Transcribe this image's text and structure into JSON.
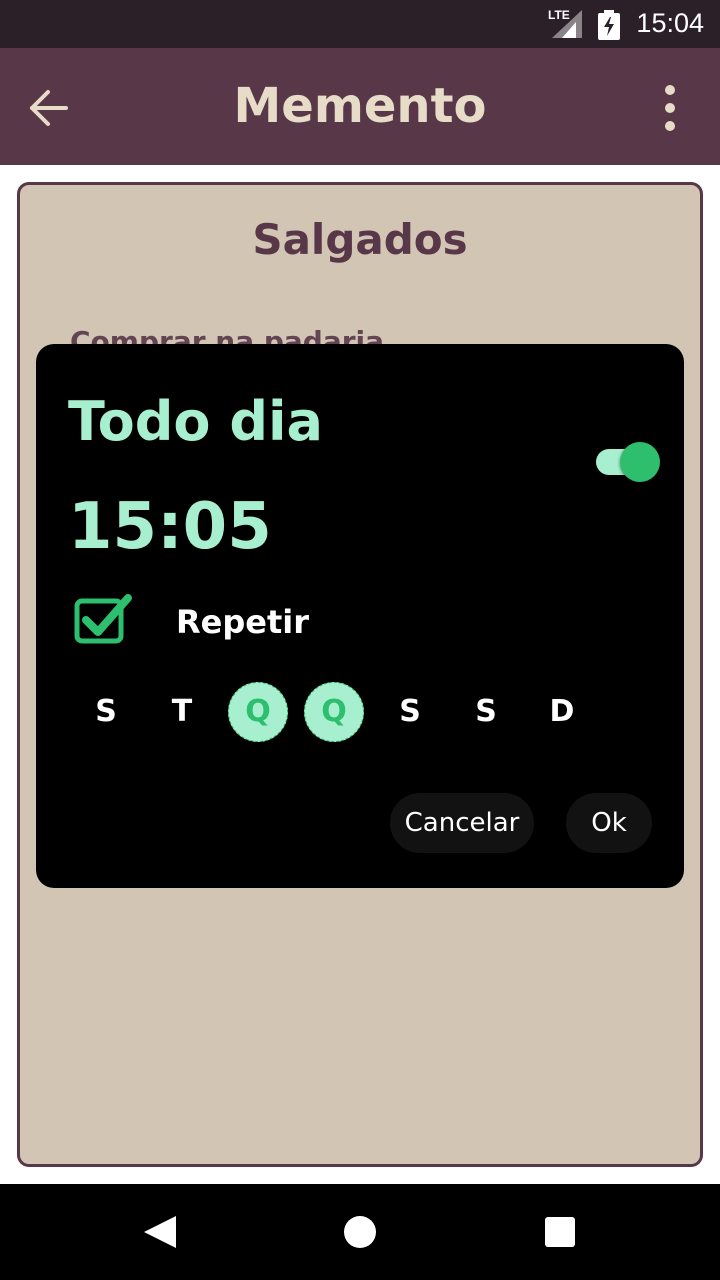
{
  "status_bar": {
    "network": "LTE",
    "time": "15:04",
    "icons": [
      "signal-icon",
      "battery-charging-icon"
    ]
  },
  "app_bar": {
    "title": "Memento",
    "icons": [
      "back-arrow-icon",
      "more-vert-icon"
    ]
  },
  "card": {
    "title": "Salgados",
    "note": "Comprar na padaria"
  },
  "dialog": {
    "title": "Todo dia",
    "time": "15:05",
    "enabled": true,
    "repeat_checked": true,
    "repeat_label": "Repetir",
    "days": [
      {
        "label": "S",
        "selected": false
      },
      {
        "label": "T",
        "selected": false
      },
      {
        "label": "Q",
        "selected": true
      },
      {
        "label": "Q",
        "selected": true
      },
      {
        "label": "S",
        "selected": false
      },
      {
        "label": "S",
        "selected": false
      },
      {
        "label": "D",
        "selected": false
      }
    ],
    "cancel_label": "Cancelar",
    "ok_label": "Ok"
  },
  "nav_bar": {
    "icons": [
      "nav-back-icon",
      "nav-home-icon",
      "nav-recent-icon"
    ]
  },
  "colors": {
    "app_bar": "#573748",
    "title_text": "#e6dcc8",
    "card_bg": "#d2c5b4",
    "accent": "#a8efd0",
    "accent_strong": "#2dbf6e",
    "dialog_bg": "#000000"
  }
}
